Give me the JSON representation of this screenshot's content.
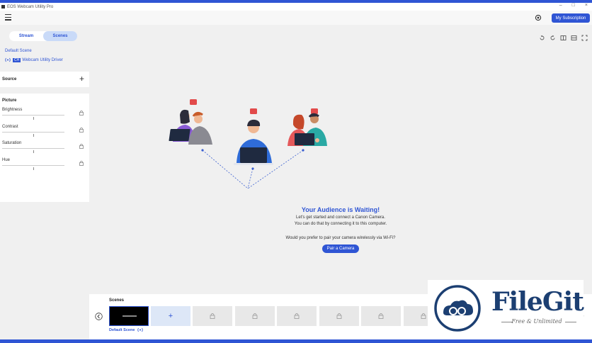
{
  "window": {
    "title": "EOS Webcam Utility Pro",
    "controls": [
      "–",
      "□",
      "×"
    ]
  },
  "header": {
    "subscription_label": "My Subscription"
  },
  "sidebar": {
    "tabs": [
      {
        "label": "Stream",
        "active": false
      },
      {
        "label": "Scenes",
        "active": true
      }
    ],
    "scene_name": "Default Scene",
    "driver": {
      "channel_badge": "CH",
      "label": "Webcam Utility Driver"
    },
    "source_label": "Source",
    "picture": {
      "title": "Picture",
      "sliders": [
        {
          "label": "Brightness",
          "level": 0.5
        },
        {
          "label": "Contrast",
          "level": 0.5
        },
        {
          "label": "Saturation",
          "level": 0.5
        },
        {
          "label": "Hue",
          "level": 0.5
        }
      ]
    }
  },
  "main": {
    "message": {
      "title": "Your Audience is Waiting!",
      "line1": "Let's get started and connect a  Canon Camera.",
      "line2": "You can do that by connecting it to this computer.",
      "line3": "Would you prefer to pair your camera wirelessly via Wi-Fi?",
      "button": "Pair a Camera"
    }
  },
  "scenes_strip": {
    "title": "Scenes",
    "current_scene_caption": "Default Scene",
    "add_symbol": "+",
    "locked_slots": 6
  },
  "watermark": {
    "name": "FileGit",
    "tagline": "Free & Unlimited"
  },
  "colors": {
    "accent": "#2f55d4",
    "watermark_blue": "#1c3f72"
  }
}
